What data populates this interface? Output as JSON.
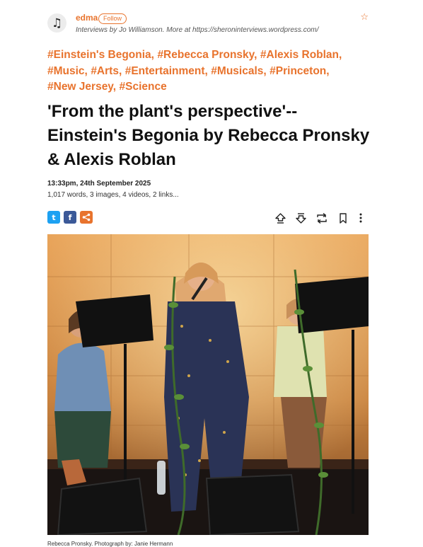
{
  "header": {
    "avatar_icon": "music-note-icon",
    "author": "edma",
    "follow_label": "Follow",
    "byline": "Interviews by Jo Williamson. More at https://sheroninterviews.wordpress.com/",
    "star_icon": "star-outline-icon"
  },
  "tags": [
    "#Einstein's Begonia,",
    "#Rebecca Pronsky,",
    "#Alexis Roblan,",
    "#Music,",
    "#Arts,",
    "#Entertainment,",
    "#Musicals,",
    "#Princeton,",
    "#New Jersey,",
    "#Science"
  ],
  "title": "'From the plant's perspective'--Einstein's Begonia by Rebecca Pronsky & Alexis Roblan",
  "meta": {
    "date": "13:33pm, 24th September 2025",
    "counts": "1,017 words, 3 images, 4 videos, 2 links..."
  },
  "share": {
    "twitter_glyph": "t",
    "facebook_glyph": "f"
  },
  "actions": [
    "upvote-icon",
    "downvote-icon",
    "repost-icon",
    "bookmark-icon",
    "more-icon"
  ],
  "caption": "Rebecca Pronsky. Photograph by: Janie Hermann",
  "colors": {
    "accent": "#e8732d",
    "twitter": "#1da1f2",
    "facebook": "#3b5998"
  }
}
